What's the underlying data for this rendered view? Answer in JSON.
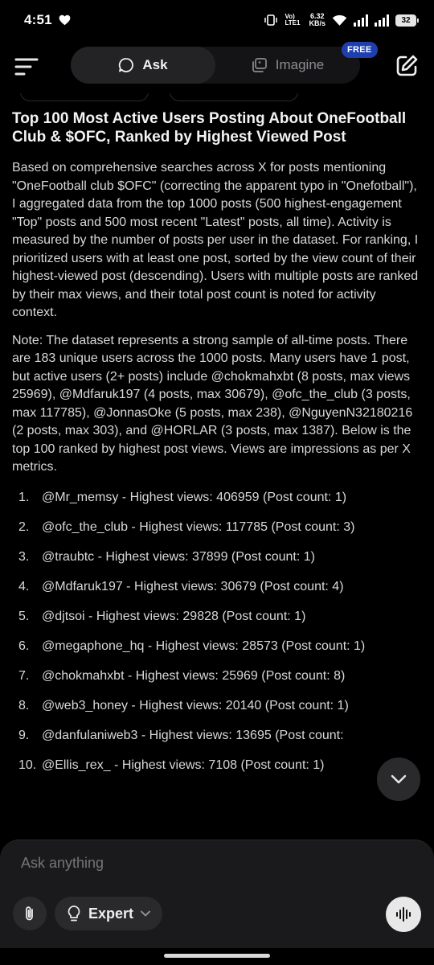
{
  "status": {
    "time": "4:51",
    "volte": "Vo) LTE1",
    "net_speed": "6.32",
    "net_unit": "KB/s",
    "battery": "32"
  },
  "topbar": {
    "tab_ask": "Ask",
    "tab_imagine": "Imagine",
    "badge": "FREE"
  },
  "article": {
    "title": "Top 100 Most Active Users Posting About OneFootball Club & $OFC, Ranked by Highest Viewed Post",
    "intro": "Based on comprehensive searches across X for posts mentioning \"OneFootball club $OFC\" (correcting the apparent typo in \"Onefotball\"), I aggregated data from the top 1000 posts (500 highest-engagement \"Top\" posts and 500 most recent \"Latest\" posts, all time). Activity is measured by the number of posts per user in the dataset. For ranking, I prioritized users with at least one post, sorted by the view count of their highest-viewed post (descending). Users with multiple posts are ranked by their max views, and their total post count is noted for activity context.",
    "note": "Note: The dataset represents a strong sample of all-time posts. There are 183 unique users across the 1000 posts. Many users have 1 post, but active users (2+ posts) include @chokmahxbt (8 posts, max views 25969), @Mdfaruk197 (4 posts, max 30679), @ofc_the_club (3 posts, max 117785), @JonnasOke (5 posts, max 238), @NguyenN32180216 (2 posts, max 303), and @HORLAR (3 posts, max 1387). Below is the top 100 ranked by highest post views. Views are impressions as per X metrics.",
    "items": [
      {
        "num": "1.",
        "text": "@Mr_memsy - Highest views: 406959 (Post count: 1)"
      },
      {
        "num": "2.",
        "text": "@ofc_the_club - Highest views: 117785 (Post count: 3)"
      },
      {
        "num": "3.",
        "text": "@traubtc - Highest views: 37899 (Post count: 1)"
      },
      {
        "num": "4.",
        "text": "@Mdfaruk197 - Highest views: 30679 (Post count: 4)"
      },
      {
        "num": "5.",
        "text": "@djtsoi - Highest views: 29828 (Post count: 1)"
      },
      {
        "num": "6.",
        "text": "@megaphone_hq - Highest views: 28573 (Post count: 1)"
      },
      {
        "num": "7.",
        "text": "@chokmahxbt - Highest views: 25969 (Post count: 8)"
      },
      {
        "num": "8.",
        "text": "@web3_honey - Highest views: 20140 (Post count: 1)"
      },
      {
        "num": "9.",
        "text": "@danfulaniweb3 - Highest views: 13695 (Post count:"
      },
      {
        "num": "10.",
        "text": "@Ellis_rex_ - Highest views: 7108 (Post count: 1)"
      }
    ]
  },
  "composer": {
    "placeholder": "Ask anything",
    "mode_label": "Expert"
  }
}
